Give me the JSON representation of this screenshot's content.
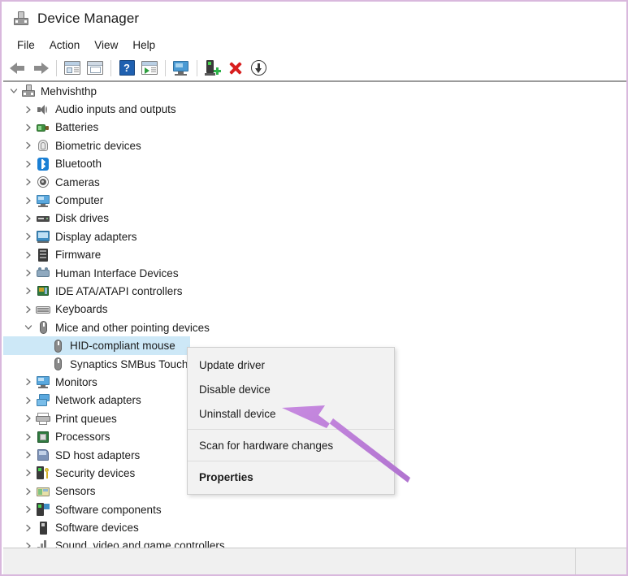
{
  "window": {
    "title": "Device Manager",
    "title_icon": "device-manager-icon"
  },
  "menubar": {
    "items": [
      {
        "label": "File",
        "name": "menu-file"
      },
      {
        "label": "Action",
        "name": "menu-action"
      },
      {
        "label": "View",
        "name": "menu-view"
      },
      {
        "label": "Help",
        "name": "menu-help"
      }
    ]
  },
  "toolbar": {
    "buttons": [
      {
        "name": "back-button",
        "icon": "back-arrow-icon"
      },
      {
        "name": "forward-button",
        "icon": "forward-arrow-icon"
      },
      {
        "name": "show-hide-console-tree-button",
        "icon": "console-tree-icon"
      },
      {
        "name": "properties-button",
        "icon": "properties-icon"
      },
      {
        "name": "help-button",
        "icon": "help-icon"
      },
      {
        "name": "update-driver-button",
        "icon": "update-driver-icon"
      },
      {
        "name": "scan-display-button",
        "icon": "monitor-icon"
      },
      {
        "name": "scan-for-hardware-changes-button",
        "icon": "scan-hardware-icon"
      },
      {
        "name": "uninstall-device-button",
        "icon": "red-x-icon"
      },
      {
        "name": "disable-device-button",
        "icon": "circle-down-arrow-icon"
      }
    ]
  },
  "tree": {
    "root": {
      "label": "Mehvishthp",
      "icon": "computer-root-icon",
      "expanded": true
    },
    "items": [
      {
        "label": "Audio inputs and outputs",
        "icon": "speaker-icon",
        "expanded": false,
        "indent": 1
      },
      {
        "label": "Batteries",
        "icon": "battery-icon",
        "expanded": false,
        "indent": 1
      },
      {
        "label": "Biometric devices",
        "icon": "fingerprint-icon",
        "expanded": false,
        "indent": 1
      },
      {
        "label": "Bluetooth",
        "icon": "bluetooth-icon",
        "expanded": false,
        "indent": 1
      },
      {
        "label": "Cameras",
        "icon": "camera-icon",
        "expanded": false,
        "indent": 1
      },
      {
        "label": "Computer",
        "icon": "monitor-icon",
        "expanded": false,
        "indent": 1
      },
      {
        "label": "Disk drives",
        "icon": "disk-drive-icon",
        "expanded": false,
        "indent": 1
      },
      {
        "label": "Display adapters",
        "icon": "display-adapter-icon",
        "expanded": false,
        "indent": 1
      },
      {
        "label": "Firmware",
        "icon": "firmware-chip-icon",
        "expanded": false,
        "indent": 1
      },
      {
        "label": "Human Interface Devices",
        "icon": "hid-icon",
        "expanded": false,
        "indent": 1
      },
      {
        "label": "IDE ATA/ATAPI controllers",
        "icon": "ide-controller-icon",
        "expanded": false,
        "indent": 1
      },
      {
        "label": "Keyboards",
        "icon": "keyboard-icon",
        "expanded": false,
        "indent": 1
      },
      {
        "label": "Mice and other pointing devices",
        "icon": "mouse-icon",
        "expanded": true,
        "indent": 1
      },
      {
        "label": "HID-compliant mouse",
        "icon": "mouse-icon",
        "leaf": true,
        "selected": true,
        "indent": 2
      },
      {
        "label": "Synaptics SMBus TouchPad",
        "icon": "mouse-icon",
        "leaf": true,
        "indent": 2
      },
      {
        "label": "Monitors",
        "icon": "monitor-icon",
        "expanded": false,
        "indent": 1
      },
      {
        "label": "Network adapters",
        "icon": "network-adapter-icon",
        "expanded": false,
        "indent": 1
      },
      {
        "label": "Print queues",
        "icon": "printer-icon",
        "expanded": false,
        "indent": 1
      },
      {
        "label": "Processors",
        "icon": "processor-icon",
        "expanded": false,
        "indent": 1
      },
      {
        "label": "SD host adapters",
        "icon": "sd-adapter-icon",
        "expanded": false,
        "indent": 1
      },
      {
        "label": "Security devices",
        "icon": "security-device-icon",
        "expanded": false,
        "indent": 1
      },
      {
        "label": "Sensors",
        "icon": "sensor-icon",
        "expanded": false,
        "indent": 1
      },
      {
        "label": "Software components",
        "icon": "software-component-icon",
        "expanded": false,
        "indent": 1
      },
      {
        "label": "Software devices",
        "icon": "software-device-icon",
        "expanded": false,
        "indent": 1
      },
      {
        "label": "Sound, video and game controllers",
        "icon": "sound-icon",
        "expanded": false,
        "indent": 1
      }
    ]
  },
  "context_menu": {
    "items": [
      {
        "label": "Update driver",
        "name": "ctx-update-driver",
        "type": "item"
      },
      {
        "label": "Disable device",
        "name": "ctx-disable-device",
        "type": "item"
      },
      {
        "label": "Uninstall device",
        "name": "ctx-uninstall-device",
        "type": "item"
      },
      {
        "type": "separator"
      },
      {
        "label": "Scan for hardware changes",
        "name": "ctx-scan-hardware",
        "type": "item"
      },
      {
        "type": "separator"
      },
      {
        "label": "Properties",
        "name": "ctx-properties",
        "type": "item",
        "bold": true
      }
    ]
  },
  "annotation": {
    "type": "arrow",
    "color": "#bd82da",
    "points_to": "Uninstall device"
  },
  "colors": {
    "selection": "#cde8f7",
    "frame_border": "#d9b8dd",
    "menu_background": "#f2f2f2",
    "status_background": "#f0f0f0"
  }
}
